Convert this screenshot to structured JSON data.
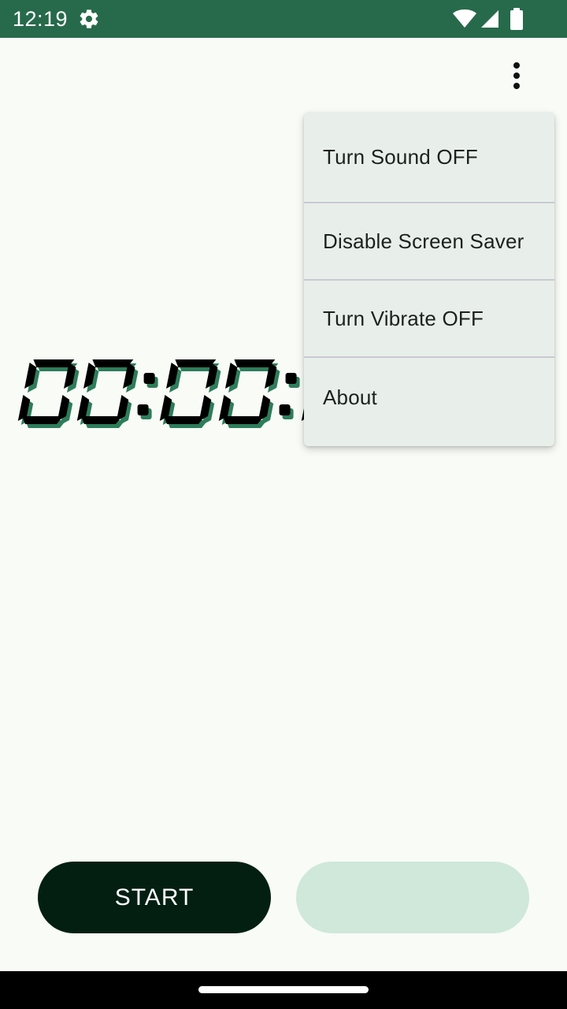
{
  "status_bar": {
    "time": "12:19",
    "icons": [
      "gear-icon",
      "wifi-icon",
      "signal-icon",
      "battery-icon"
    ],
    "background_color": "#276a4b"
  },
  "toolbar": {
    "overflow_icon": "more-vert-icon"
  },
  "timer": {
    "display": "00:00:00",
    "digit_color": "#000000",
    "shadow_color": "#2e7d5a"
  },
  "menu": {
    "items": [
      {
        "label": "Turn Sound OFF"
      },
      {
        "label": "Disable Screen Saver"
      },
      {
        "label": "Turn Vibrate OFF"
      },
      {
        "label": "About"
      }
    ]
  },
  "controls": {
    "start_label": "START",
    "start_color": "#021f12",
    "secondary_color": "#cfe8da"
  }
}
